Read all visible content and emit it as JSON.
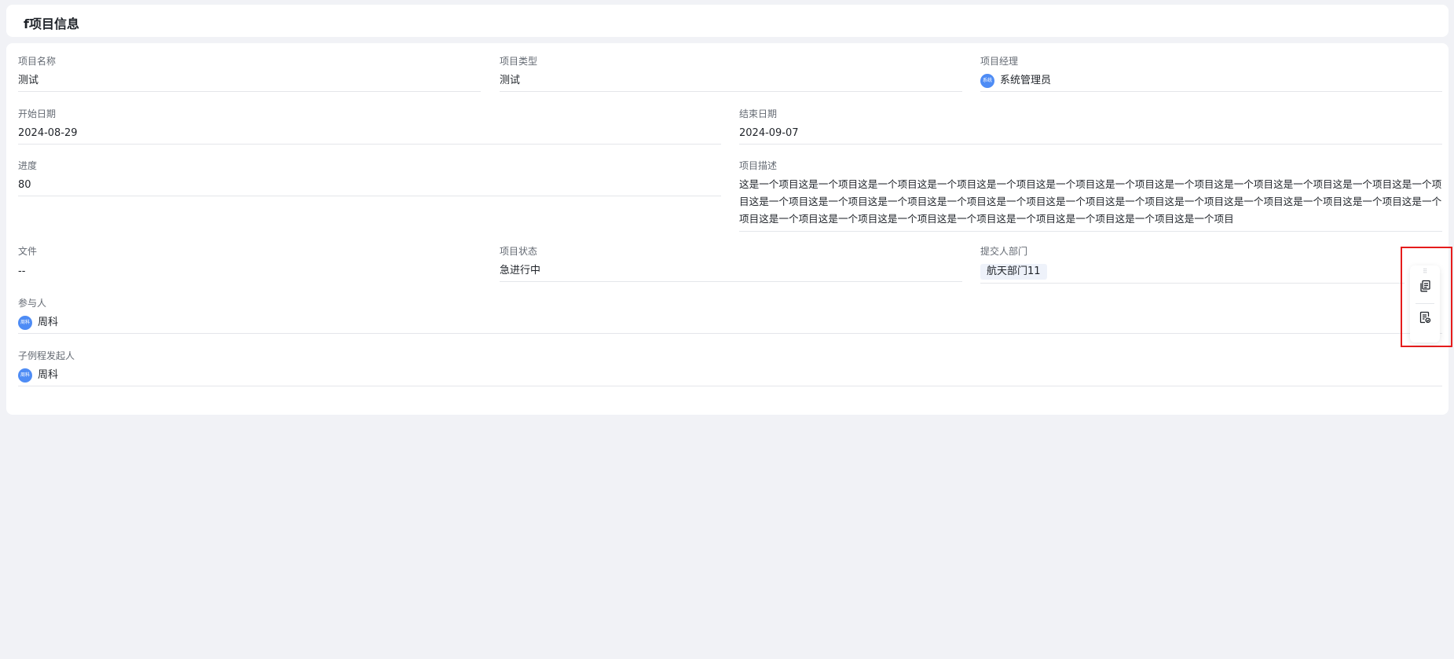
{
  "page": {
    "title": "f项目信息"
  },
  "fields": {
    "project_name": {
      "label": "项目名称",
      "value": "测试"
    },
    "project_type": {
      "label": "项目类型",
      "value": "测试"
    },
    "project_manager": {
      "label": "项目经理",
      "avatar_text": "系统",
      "value": "系统管理员"
    },
    "start_date": {
      "label": "开始日期",
      "value": "2024-08-29"
    },
    "end_date": {
      "label": "结束日期",
      "value": "2024-09-07"
    },
    "progress": {
      "label": "进度",
      "value": "80"
    },
    "description": {
      "label": "项目描述",
      "value": "这是一个项目这是一个项目这是一个项目这是一个项目这是一个项目这是一个项目这是一个项目这是一个项目这是一个项目这是一个项目这是一个项目这是一个项目这是一个项目这是一个项目这是一个项目这是一个项目这是一个项目这是一个项目这是一个项目这是一个项目这是一个项目这是一个项目这是一个项目这是一个项目这是一个项目这是一个项目这是一个项目这是一个项目这是一个项目这是一个项目这是一个项目这是一个项目"
    },
    "file": {
      "label": "文件",
      "value": "--"
    },
    "project_status": {
      "label": "项目状态",
      "value": "急进行中"
    },
    "submitter_dept": {
      "label": "提交人部门",
      "value": "航天部门11"
    },
    "participants": {
      "label": "参与人",
      "avatar_text": "周科",
      "value": "周科"
    },
    "subprocess_initiator": {
      "label": "子例程发起人",
      "avatar_text": "周科",
      "value": "周科"
    }
  },
  "float_toolbar": {
    "buttons": [
      {
        "icon": "copy-icon"
      },
      {
        "icon": "form-check-icon"
      }
    ]
  },
  "colors": {
    "page_bg": "#f1f2f6",
    "card_bg": "#ffffff",
    "avatar": "#4e8cf5",
    "highlight_border": "#e51c1c",
    "tag_bg": "#eef2fa"
  }
}
